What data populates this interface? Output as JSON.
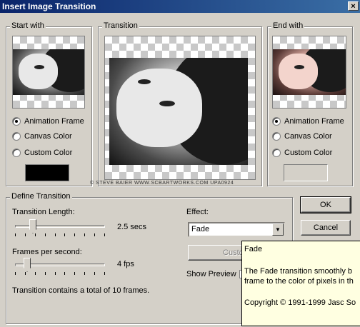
{
  "window": {
    "title": "Insert Image Transition",
    "close_glyph": "×"
  },
  "start_with": {
    "legend": "Start with",
    "options": [
      "Animation Frame",
      "Canvas Color",
      "Custom Color"
    ],
    "selected": "Animation Frame",
    "custom_color": "#000000"
  },
  "transition": {
    "legend": "Transition",
    "credit": "© STEVE BAIER WWW.SCBARTWORKS.COM UPA0924"
  },
  "end_with": {
    "legend": "End with",
    "options": [
      "Animation Frame",
      "Canvas Color",
      "Custom Color"
    ],
    "selected": "Animation Frame"
  },
  "define": {
    "legend": "Define Transition",
    "length_label": "Transition Length:",
    "length_value": "2.5 secs",
    "length_fraction": 0.17,
    "fps_label": "Frames per second:",
    "fps_value": "4 fps",
    "fps_fraction": 0.1,
    "summary": "Transition contains a total of 10 frames.",
    "effect_label": "Effect:",
    "effect_value": "Fade",
    "customize_label": "Custom",
    "show_preview_label": "Show Preview"
  },
  "buttons": {
    "ok": "OK",
    "cancel": "Cancel"
  },
  "tooltip": {
    "title": "Fade",
    "line1": "The Fade transition smoothly b",
    "line2": "frame to the color of pixels in th",
    "copyright": "Copyright © 1991-1999 Jasc So"
  }
}
